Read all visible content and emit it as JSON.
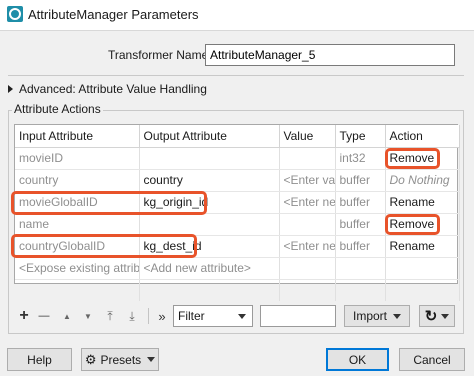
{
  "window": {
    "title": "AttributeManager Parameters"
  },
  "transformer": {
    "label": "Transformer Name:",
    "value": "AttributeManager_5"
  },
  "advanced": {
    "label": "Advanced: Attribute Value Handling"
  },
  "actions": {
    "group_title": "Attribute Actions",
    "columns": [
      "Input Attribute",
      "Output Attribute",
      "Value",
      "Type",
      "Action"
    ],
    "rows": [
      {
        "input": "movieID",
        "output": "",
        "value": "",
        "type": "int32",
        "action": "Remove"
      },
      {
        "input": "country",
        "output": "country",
        "value": "<Enter value>",
        "type": "buffer",
        "action": "Do Nothing"
      },
      {
        "input": "movieGlobalID",
        "output": "kg_origin_id",
        "value": "<Enter new",
        "type": "buffer",
        "action": "Rename"
      },
      {
        "input": "name",
        "output": "",
        "value": "",
        "type": "buffer",
        "action": "Remove"
      },
      {
        "input": "countryGlobalID",
        "output": "kg_dest_id",
        "value": "<Enter new",
        "type": "buffer",
        "action": "Rename"
      },
      {
        "input": "<Expose existing attribute>",
        "output": "<Add new attribute>",
        "value": "",
        "type": "",
        "action": ""
      }
    ]
  },
  "toolbar": {
    "add": "+",
    "remove": "—",
    "move_up": "▲",
    "move_down": "▼",
    "move_top": "⤒",
    "move_bottom": "⤓",
    "collapse": "»",
    "filter_value": "Filter",
    "import_label": "Import",
    "refresh": "↻"
  },
  "footer": {
    "help": "Help",
    "presets": "Presets",
    "ok": "OK",
    "cancel": "Cancel"
  },
  "colors": {
    "highlight": "#e8532a",
    "accent": "#0078d7",
    "app_icon": "#1f8ea8"
  }
}
